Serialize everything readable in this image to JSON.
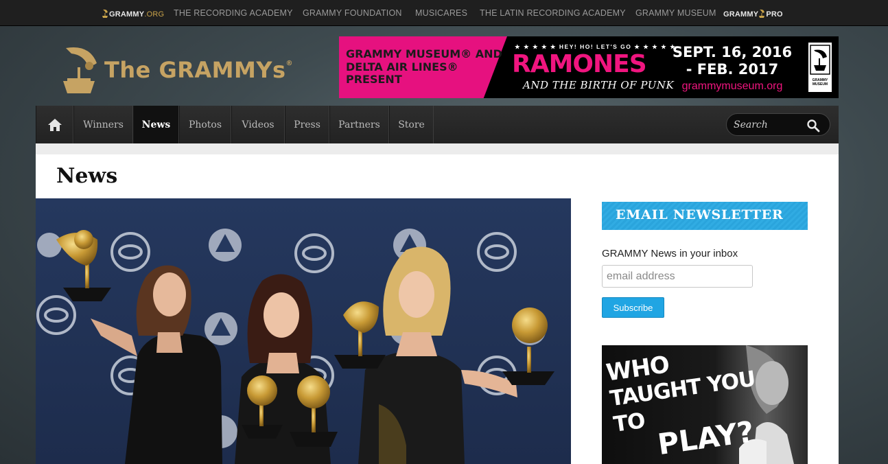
{
  "topbar": {
    "logo_main": "GRAMMY",
    "logo_suffix": ".org",
    "links": [
      "THE RECORDING ACADEMY",
      "GRAMMY FOUNDATION",
      "MUSICARES",
      "THE LATIN RECORDING ACADEMY",
      "GRAMMY MUSEUM"
    ],
    "pro_main": "GRAMMY",
    "pro_suffix": "PRO"
  },
  "header": {
    "logo_text": "The GRAMMYs",
    "logo_mark": "®",
    "logo_icon": "gramophone-icon"
  },
  "banner": {
    "left_text": "GRAMMY MUSEUM® AND DELTA AIR LINES® PRESENT",
    "tagline": "★ ★ ★ ★ ★ HEY! HO! LET'S GO ★ ★ ★ ★ ★",
    "headline": "RAMONES",
    "subline": "AND THE BIRTH OF PUNK",
    "dates_line1": "SEPT. 16, 2016",
    "dates_line2": "- FEB. 2017",
    "url": "grammymuseum.org",
    "logo_text": "GRAMMY MUSEUM",
    "accent_color": "#e6117f"
  },
  "nav": {
    "home_icon": "home-icon",
    "items": [
      {
        "label": "Winners",
        "active": false
      },
      {
        "label": "News",
        "active": true
      },
      {
        "label": "Photos",
        "active": false
      },
      {
        "label": "Videos",
        "active": false
      },
      {
        "label": "Press",
        "active": false
      },
      {
        "label": "Partners",
        "active": false
      },
      {
        "label": "Store",
        "active": false
      }
    ],
    "search_placeholder": "Search",
    "search_icon": "search-icon"
  },
  "main": {
    "title": "News"
  },
  "sidebar": {
    "newsletter_title": "EMAIL NEWSLETTER",
    "newsletter_desc": "GRAMMY News in your inbox",
    "email_placeholder": "email address",
    "subscribe_label": "Subscribe",
    "ad_line1": "WHO",
    "ad_line2": "TAUGHT YOU TO",
    "ad_line3": "PLAY?"
  },
  "colors": {
    "newsletter_blue": "#2aa4dc",
    "logo_gold": "#c6a363",
    "nav_bg": "#2a2a2a"
  }
}
